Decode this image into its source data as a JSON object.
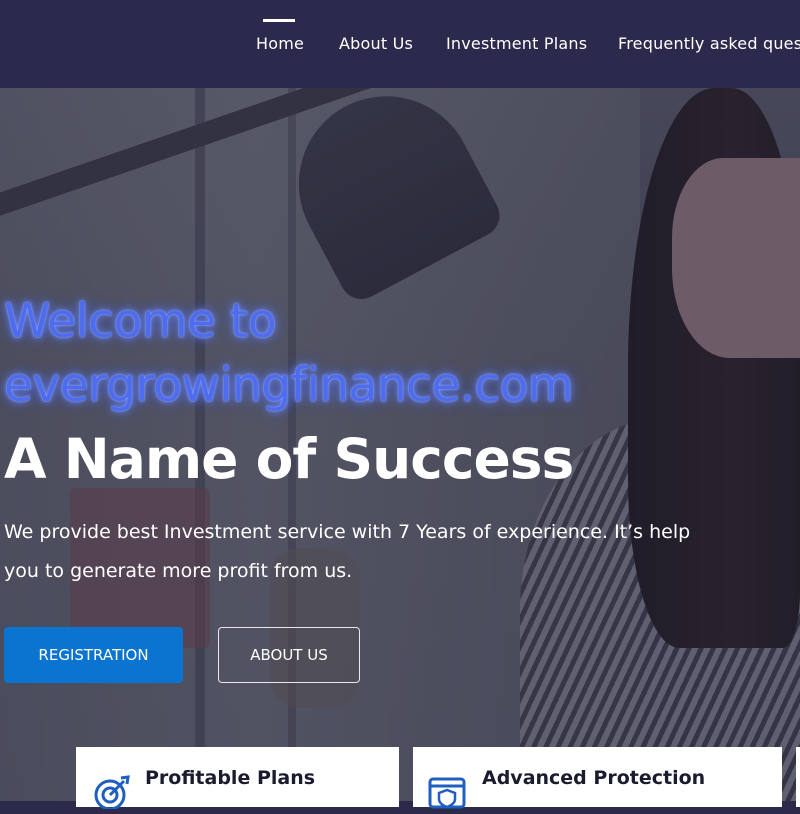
{
  "nav": {
    "items": [
      {
        "label": "Home",
        "active": true
      },
      {
        "label": "About Us"
      },
      {
        "label": "Investment Plans"
      },
      {
        "label": "Frequently asked questions"
      }
    ]
  },
  "hero": {
    "welcome_line1": "Welcome to",
    "welcome_line2": "evergrowingfinance.com",
    "headline": "A Name of Success",
    "description": "We provide best Investment service with 7 Years of experience. It’s help you to generate more profit from us.",
    "buttons": {
      "registration": "REGISTRATION",
      "about": "ABOUT US"
    }
  },
  "features": [
    {
      "title": "Profitable Plans",
      "icon": "target-arrow-icon"
    },
    {
      "title": "Advanced Protection",
      "icon": "shield-browser-icon"
    }
  ],
  "colors": {
    "nav_bg": "#2b2a4c",
    "accent_blue": "#0a74d0",
    "neon_text": "#4d6cf0",
    "icon_blue": "#1f5fbf"
  }
}
